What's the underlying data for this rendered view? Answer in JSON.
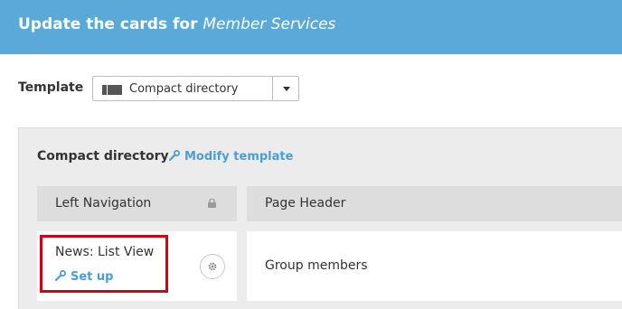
{
  "header": {
    "title_prefix": "Update the cards for",
    "group_name": "Member Services"
  },
  "template": {
    "label": "Template",
    "selected": "Compact directory"
  },
  "panel": {
    "title": "Compact directory",
    "modify_link": "Modify template"
  },
  "columns": {
    "left": "Left Navigation",
    "main": "Page Header"
  },
  "cards": {
    "left": {
      "title": "News: List View",
      "setup_link": "Set up"
    },
    "main": {
      "title": "Group members"
    }
  },
  "colors": {
    "header_bg": "#5aa9d8",
    "link": "#4a9ed4",
    "highlight": "#d0021b"
  },
  "icons": [
    "layout-icon",
    "caret-down-icon",
    "wrench-icon",
    "lock-icon",
    "gear-icon"
  ]
}
